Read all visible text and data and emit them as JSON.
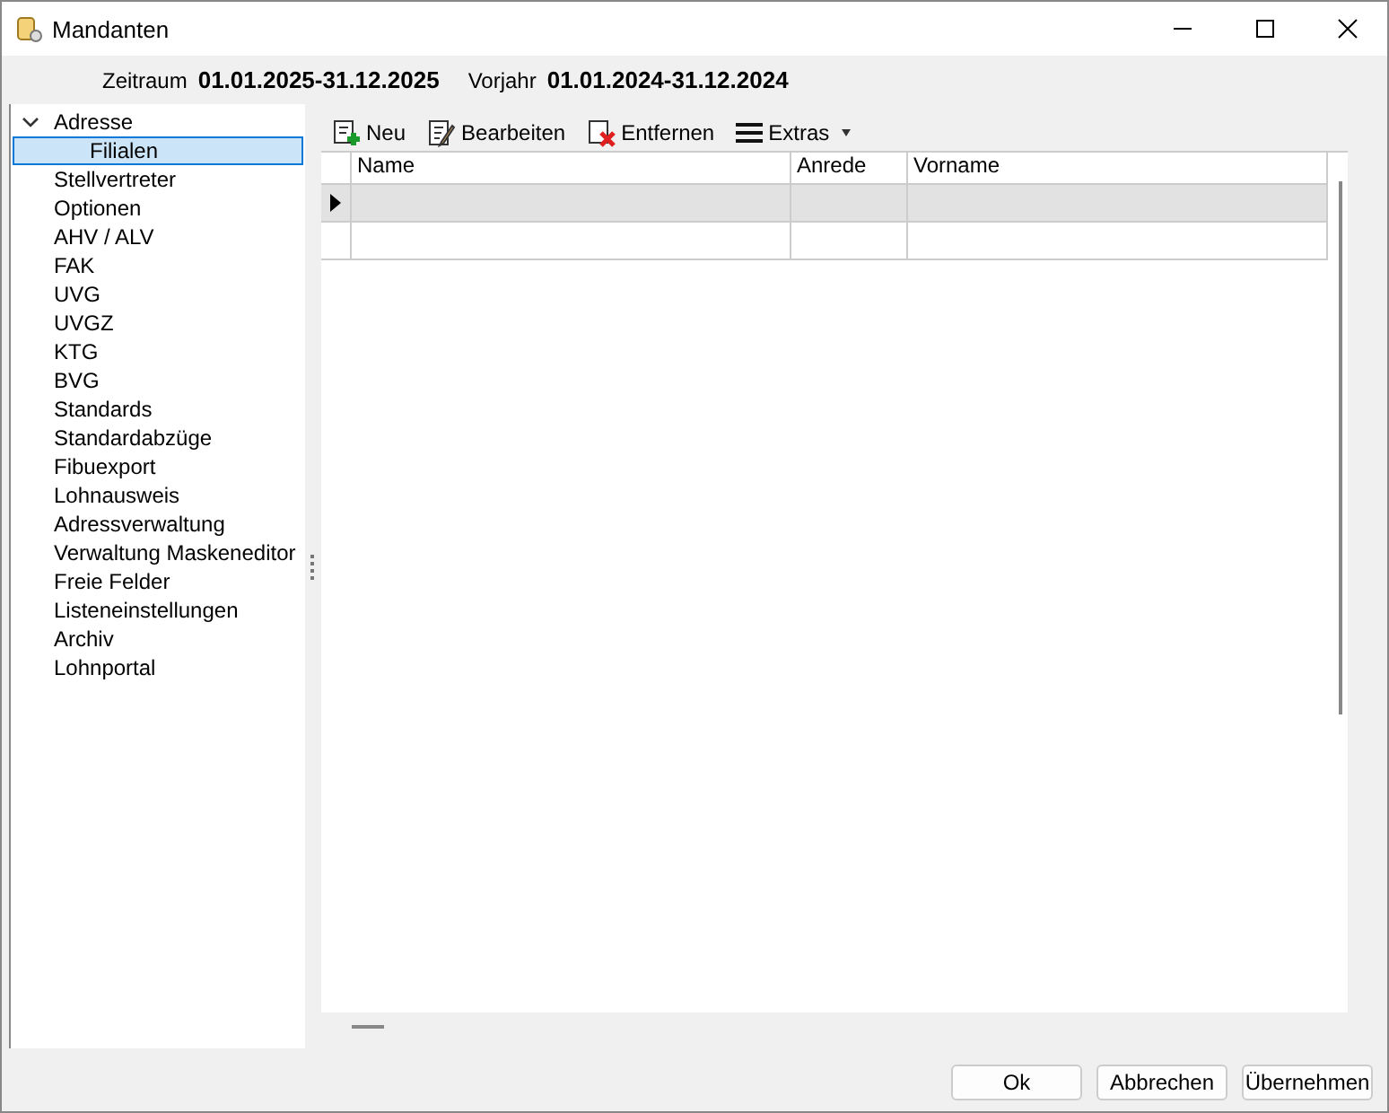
{
  "window": {
    "title": "Mandanten"
  },
  "period": {
    "label": "Zeitraum",
    "value": "01.01.2025-31.12.2025",
    "prev_label": "Vorjahr",
    "prev_value": "01.01.2024-31.12.2024"
  },
  "tree": [
    {
      "label": "Adresse",
      "expanded": true,
      "selected": false,
      "children": [
        {
          "label": "Filialen",
          "selected": true
        }
      ]
    },
    {
      "label": "Stellvertreter",
      "selected": false
    },
    {
      "label": "Optionen",
      "selected": false
    },
    {
      "label": "AHV / ALV",
      "selected": false
    },
    {
      "label": "FAK",
      "selected": false
    },
    {
      "label": "UVG",
      "selected": false
    },
    {
      "label": "UVGZ",
      "selected": false
    },
    {
      "label": "KTG",
      "selected": false
    },
    {
      "label": "BVG",
      "selected": false
    },
    {
      "label": "Standards",
      "selected": false
    },
    {
      "label": "Standardabzüge",
      "selected": false
    },
    {
      "label": "Fibuexport",
      "selected": false
    },
    {
      "label": "Lohnausweis",
      "selected": false
    },
    {
      "label": "Adressverwaltung",
      "selected": false
    },
    {
      "label": "Verwaltung Maskeneditor",
      "selected": false
    },
    {
      "label": "Freie Felder",
      "selected": false
    },
    {
      "label": "Listeneinstellungen",
      "selected": false
    },
    {
      "label": "Archiv",
      "selected": false
    },
    {
      "label": "Lohnportal",
      "selected": false
    }
  ],
  "toolbar": [
    {
      "kind": "new",
      "label": "Neu"
    },
    {
      "kind": "edit",
      "label": "Bearbeiten"
    },
    {
      "kind": "delete",
      "label": "Entfernen"
    },
    {
      "kind": "menu",
      "label": "Extras"
    }
  ],
  "table": {
    "columns": [
      "Name",
      "Anrede",
      "Vorname"
    ],
    "rows": [
      {
        "selected": true
      },
      {
        "selected": false
      }
    ]
  },
  "buttons": [
    "Ok",
    "Abbrechen",
    "Übernehmen"
  ]
}
